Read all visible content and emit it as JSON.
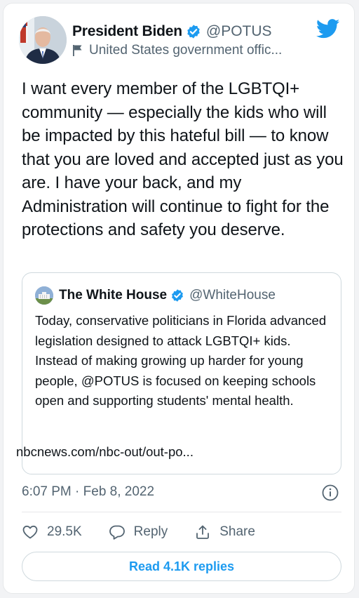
{
  "tweet": {
    "author_name": "President Biden",
    "author_handle": "@POTUS",
    "author_label": "United States government offic...",
    "text": "I want every member of the LGBTQI+ community — especially the kids who will be impacted by this hateful bill — to know that you are loved and accepted just as you are. I have your back, and my Administration will continue to fight for the protections and safety you deserve.",
    "timestamp": "6:07 PM · Feb 8, 2022"
  },
  "quote": {
    "author_name": "The White House",
    "author_handle": "@WhiteHouse",
    "text": "Today, conservative politicians in Florida advanced legislation designed to attack LGBTQI+ kids. Instead of making growing up harder for young people, @POTUS is focused on keeping schools open and supporting students' mental health.",
    "link": "nbcnews.com/nbc-out/out-po..."
  },
  "actions": {
    "like_count": "29.5K",
    "reply_label": "Reply",
    "share_label": "Share"
  },
  "read_replies_label": "Read 4.1K replies",
  "colors": {
    "brand": "#1d9bf0",
    "text": "#0f1419",
    "secondary": "#536471",
    "border": "#cfd9de"
  },
  "icons": {
    "verified": "verified-badge-icon",
    "brand": "twitter-bird-icon",
    "label": "flag-icon",
    "info": "info-icon",
    "like": "heart-icon",
    "reply": "speech-bubble-icon",
    "share": "share-icon"
  }
}
